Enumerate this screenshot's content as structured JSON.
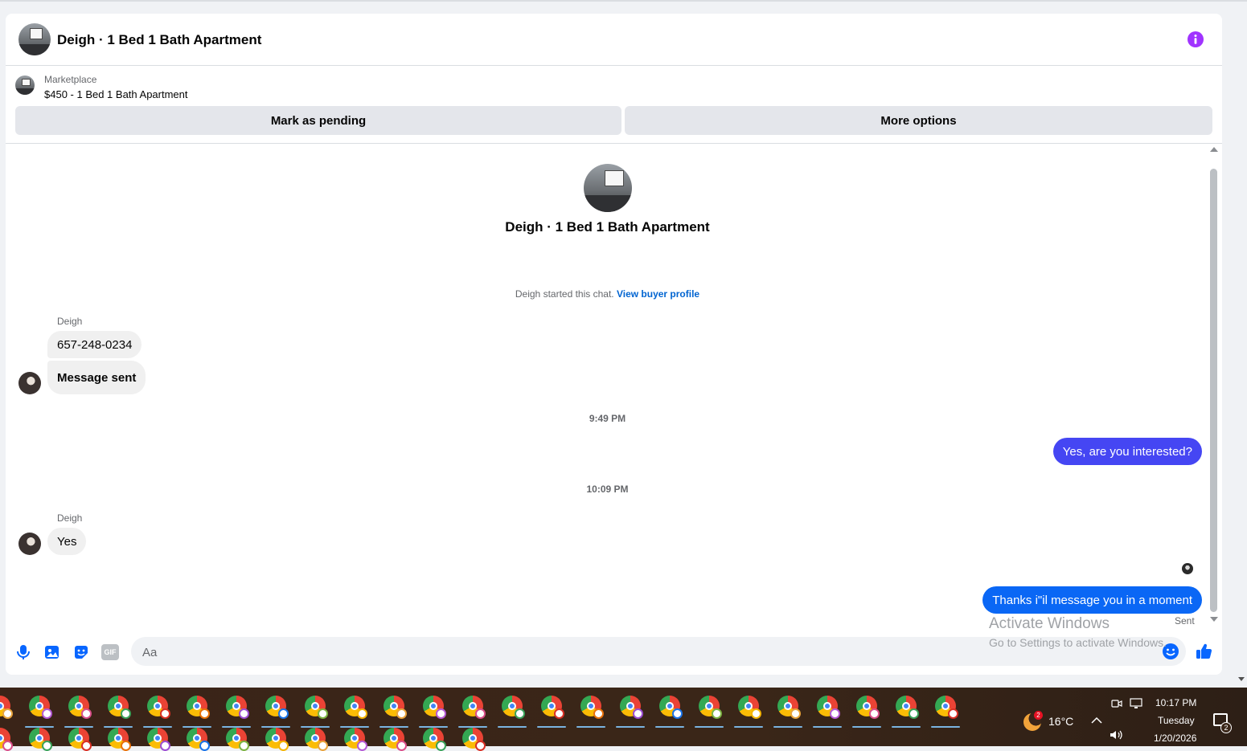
{
  "colors": {
    "accent_blue": "#0866ff",
    "bubble_out_1": "#4546f3",
    "bubble_out_2": "#0a67f5",
    "info_purple": "#a033ff",
    "bubble_in": "#f0f0f0"
  },
  "header": {
    "title": "Deigh · 1 Bed 1 Bath Apartment",
    "info_icon": "info-icon"
  },
  "marketplace": {
    "label": "Marketplace",
    "listing": "$450 - 1 Bed 1 Bath Apartment",
    "mark_pending_label": "Mark as pending",
    "more_options_label": "More options"
  },
  "conversation": {
    "intro_title": "Deigh · 1 Bed 1 Bath Apartment",
    "started_text": "Deigh started this chat.",
    "view_profile_link": "View buyer profile",
    "group1_sender": "Deigh",
    "msg1": "657-248-0234",
    "msg2": "Message sent",
    "time1": "9:49 PM",
    "out1": "Yes, are you interested?",
    "time2": "10:09 PM",
    "group2_sender": "Deigh",
    "msg3": "Yes",
    "out2": "Thanks i\"il message you in a moment",
    "sent_status": "Sent"
  },
  "composer": {
    "placeholder": "Aa",
    "icons": [
      "microphone-icon",
      "image-icon",
      "sticker-icon",
      "gif-icon",
      "emoji-icon",
      "thumbs-up-icon"
    ],
    "gif_label": "GIF"
  },
  "watermark": {
    "line1": "Activate Windows",
    "line2": "Go to Settings to activate Windows."
  },
  "taskbar": {
    "weather_badge": "2",
    "temperature": "16°C",
    "time": "10:17 PM",
    "day": "Tuesday",
    "date": "1/20/2026",
    "notification_count": "2"
  }
}
